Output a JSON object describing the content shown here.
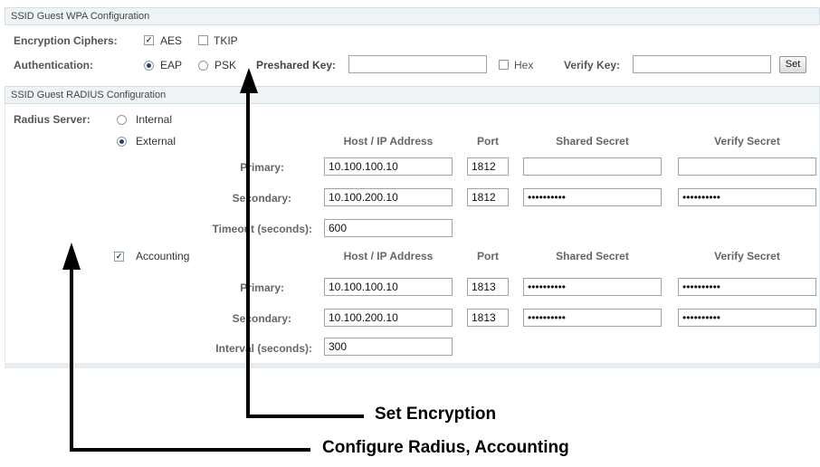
{
  "wpa": {
    "header": "SSID Guest  WPA Configuration",
    "ciphers_label": "Encryption Ciphers:",
    "aes_label": "AES",
    "aes_checked": true,
    "tkip_label": "TKIP",
    "tkip_checked": false,
    "auth_label": "Authentication:",
    "eap_label": "EAP",
    "psk_label": "PSK",
    "selected_auth": "EAP",
    "preshared_label": "Preshared Key:",
    "preshared_value": "",
    "hex_label": "Hex",
    "verify_label": "Verify Key:",
    "verify_value": "",
    "set_label": "Set"
  },
  "radius": {
    "header": "SSID Guest  RADIUS Configuration",
    "server_label": "Radius Server:",
    "internal_label": "Internal",
    "external_label": "External",
    "selected_server": "External",
    "columns": {
      "host": "Host / IP Address",
      "port": "Port",
      "secret": "Shared Secret",
      "verify": "Verify Secret"
    },
    "primary_label": "Primary:",
    "secondary_label": "Secondary:",
    "auth_primary": {
      "host": "10.100.100.10",
      "port": "1812",
      "secret": "",
      "verify": ""
    },
    "auth_secondary": {
      "host": "10.100.200.10",
      "port": "1812",
      "secret": "••••••••••",
      "verify": "••••••••••"
    },
    "timeout_label": "Timeout (seconds):",
    "timeout_value": "600",
    "accounting_label": "Accounting",
    "accounting_checked": true,
    "acct_primary": {
      "host": "10.100.100.10",
      "port": "1813",
      "secret": "••••••••••",
      "verify": "••••••••••"
    },
    "acct_secondary": {
      "host": "10.100.200.10",
      "port": "1813",
      "secret": "••••••••••",
      "verify": "••••••••••"
    },
    "interval_label": "Interval (seconds):",
    "interval_value": "300"
  },
  "callouts": {
    "encryption": "Set Encryption",
    "radius": "Configure Radius, Accounting"
  }
}
